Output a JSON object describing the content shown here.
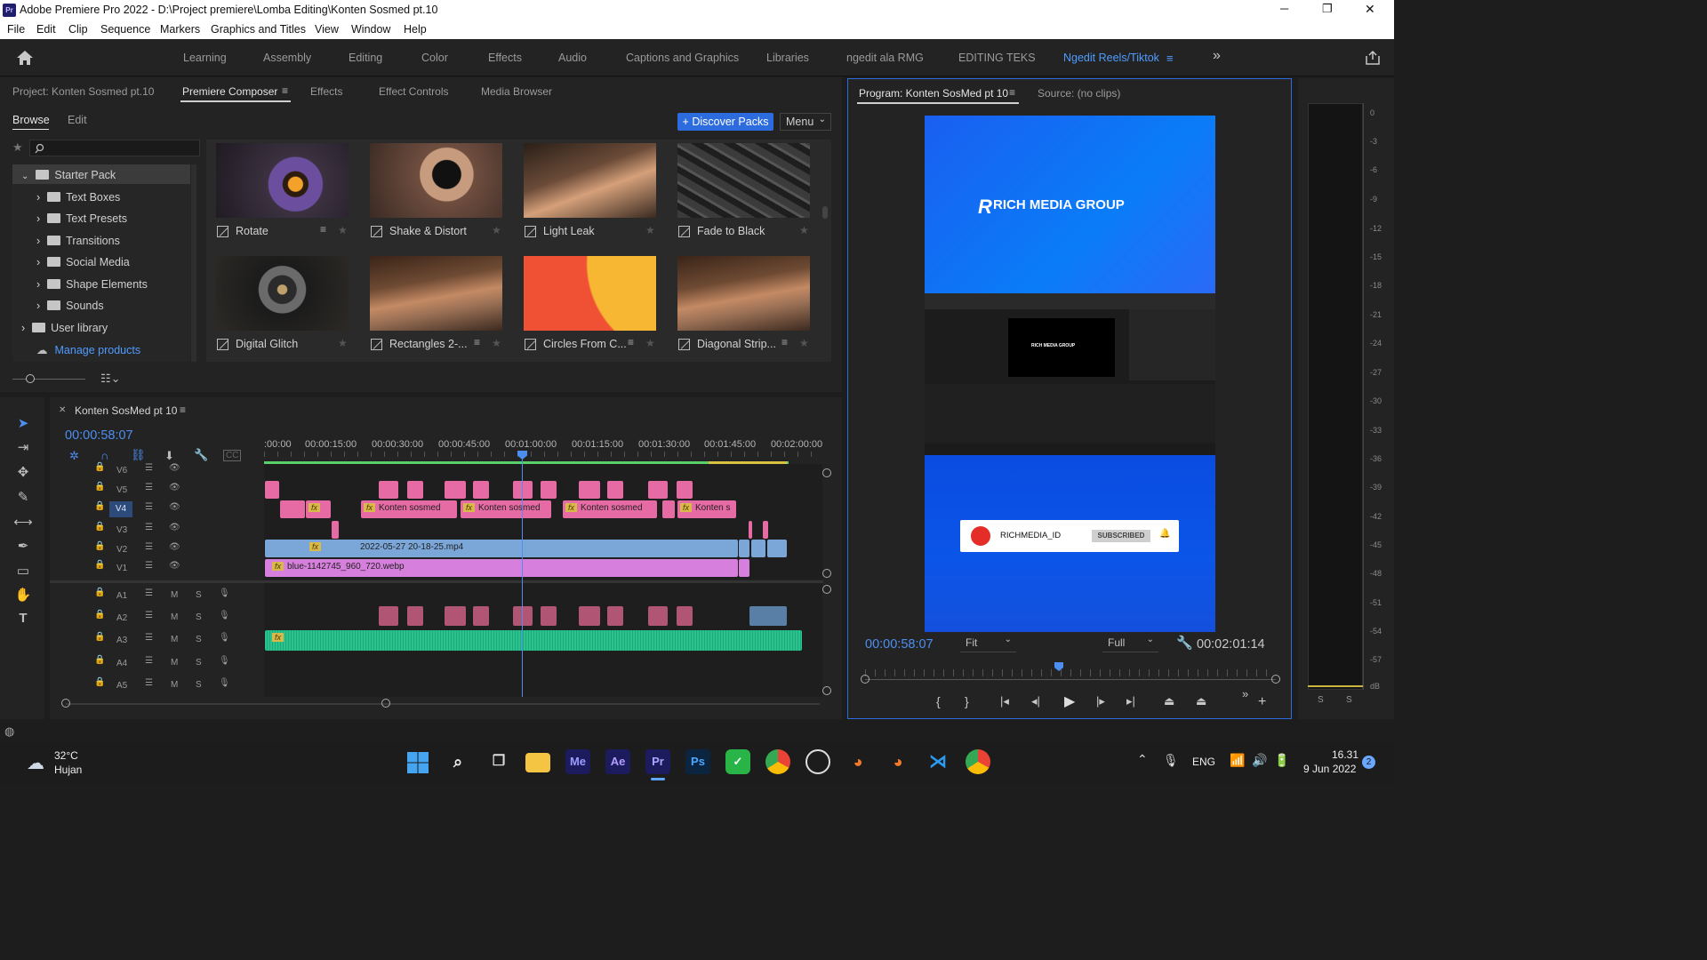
{
  "window": {
    "title": "Adobe Premiere Pro 2022 - D:\\Project premiere\\Lomba Editing\\Konten Sosmed pt.10",
    "minimize": "─",
    "restore": "❐",
    "close": "✕"
  },
  "menu": [
    "File",
    "Edit",
    "Clip",
    "Sequence",
    "Markers",
    "Graphics and Titles",
    "View",
    "Window",
    "Help"
  ],
  "workspaces": [
    "Learning",
    "Assembly",
    "Editing",
    "Color",
    "Effects",
    "Audio",
    "Captions and Graphics",
    "Libraries",
    "ngedit ala RMG",
    "EDITING TEKS",
    "Ngedit Reels/Tiktok"
  ],
  "workspace_more": "»",
  "left_tabs": [
    "Project: Konten Sosmed pt.10",
    "Premiere Composer",
    "Effects",
    "Effect Controls",
    "Media Browser"
  ],
  "composer": {
    "browse": "Browse",
    "edit": "Edit",
    "discover": "+ Discover Packs",
    "menu": "Menu",
    "tree": [
      "Starter Pack",
      "Text Boxes",
      "Text Presets",
      "Transitions",
      "Social Media",
      "Shape Elements",
      "Sounds",
      "User library"
    ],
    "manage": "Manage products",
    "items": [
      "Rotate",
      "Shake & Distort",
      "Light Leak",
      "Fade to Black",
      "Digital Glitch",
      "Rectangles 2-...",
      "Circles From C...",
      "Diagonal Strip..."
    ]
  },
  "program": {
    "tab": "Program: Konten SosMed pt 10",
    "source": "Source: (no clips)",
    "timecode": "00:00:58:07",
    "fit": "Fit",
    "quality": "Full",
    "duration": "00:02:01:14",
    "video": {
      "brand": "RICH MEDIA GROUP",
      "small_brand": "RICH MEDIA GROUP",
      "channel": "RICHMEDIA_ID",
      "subscribed": "SUBSCRIBED"
    }
  },
  "timeline": {
    "tab": "Konten SosMed pt 10",
    "timecode": "00:00:58:07",
    "ruler": [
      ":00:00",
      "00:00:15:00",
      "00:00:30:00",
      "00:00:45:00",
      "00:01:00:00",
      "00:01:15:00",
      "00:01:30:00",
      "00:01:45:00",
      "00:02:00:00"
    ],
    "video_tracks": [
      "V6",
      "V5",
      "V4",
      "V3",
      "V2",
      "V1"
    ],
    "audio_tracks": [
      "A1",
      "A2",
      "A3",
      "A4",
      "A5"
    ],
    "mute": "M",
    "solo": "S",
    "clips": {
      "v4a": "Konten sosmed",
      "v4b": "Konten sosmed",
      "v4c": "Konten sosmed",
      "v4d": "Konten s",
      "v2": "2022-05-27 20-18-25.mp4",
      "v1": "blue-1142745_960_720.webp"
    }
  },
  "meter": {
    "scale": [
      "0",
      "-3",
      "-6",
      "-9",
      "-12",
      "-15",
      "-18",
      "-21",
      "-24",
      "-27",
      "-30",
      "-33",
      "-36",
      "-39",
      "-42",
      "-45",
      "-48",
      "-51",
      "-54",
      "-57",
      "dB"
    ],
    "s1": "S",
    "s2": "S"
  },
  "taskbar": {
    "temp": "32°C",
    "weather": "Hujan",
    "lang": "ENG",
    "time": "16.31",
    "date": "9 Jun 2022",
    "badge": "2",
    "apps": [
      {
        "name": "Me",
        "bg": "#1b1b5e",
        "fg": "#9c9cff"
      },
      {
        "name": "Ae",
        "bg": "#1b1b5e",
        "fg": "#b39dff"
      },
      {
        "name": "Pr",
        "bg": "#1b1b5e",
        "fg": "#a9a9ff"
      },
      {
        "name": "Ps",
        "bg": "#0b2540",
        "fg": "#4aa8ff"
      }
    ]
  },
  "colors": {
    "accent": "#2d6cdf",
    "pink": "#e66aa3",
    "blue_clip": "#7aa6d8",
    "violet": "#d77fdc",
    "audio_green": "#29c38d",
    "playhead": "#4c8ff0"
  }
}
